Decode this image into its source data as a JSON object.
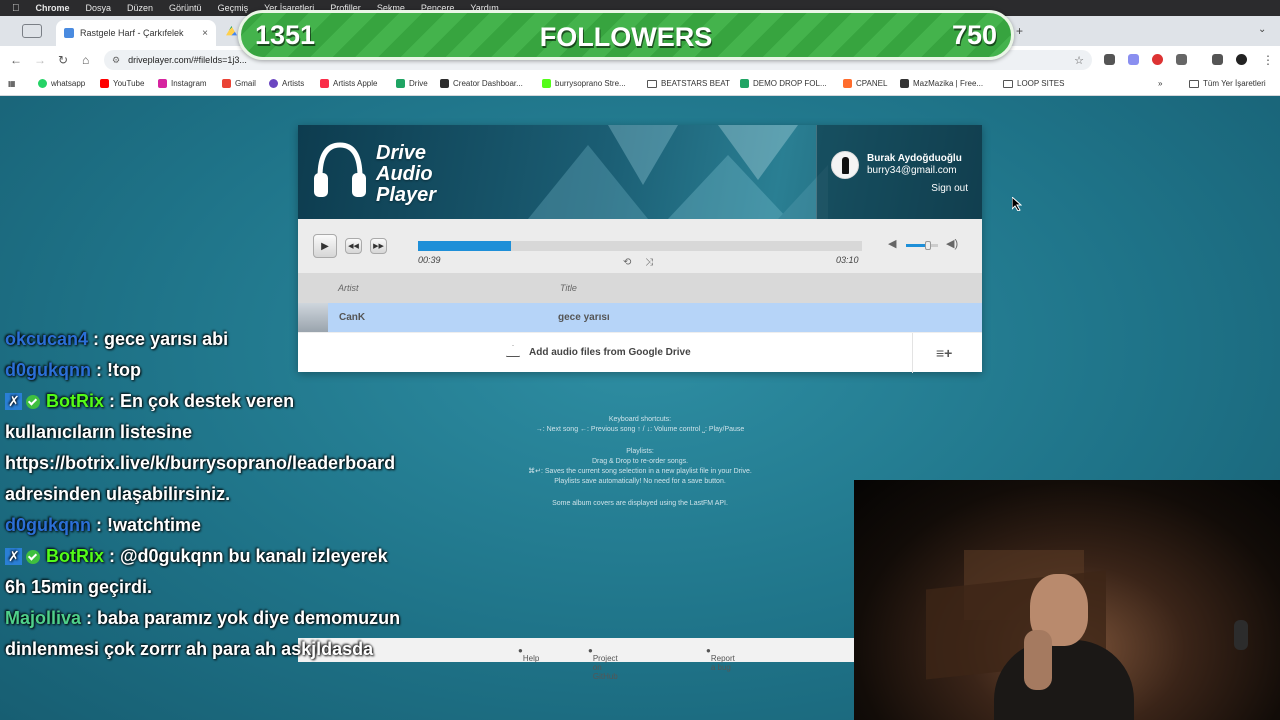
{
  "menubar": {
    "apple": "",
    "app": "Chrome",
    "items": [
      "Dosya",
      "Düzen",
      "Görüntü",
      "Geçmiş",
      "Yer İşaretleri",
      "Profiller",
      "Sekme",
      "Pencere",
      "Yardım"
    ]
  },
  "tab": {
    "title": "Rastgele Harf - Çarkıfelek",
    "close": "×"
  },
  "newtab": "+",
  "followers": {
    "left": "1351",
    "title": "FOLLOWERS",
    "right": "750"
  },
  "address": {
    "url": "driveplayer.com/#fileIds=1j3...",
    "star": "☆"
  },
  "bookmarks": [
    {
      "label": "whatsapp",
      "color": "#25d366"
    },
    {
      "label": "YouTube",
      "color": "#ff0000"
    },
    {
      "label": "Instagram",
      "color": "#d6249f"
    },
    {
      "label": "Gmail",
      "color": "#ea4335"
    },
    {
      "label": "Artists",
      "color": "#6b46c1"
    },
    {
      "label": "Artists Apple",
      "color": "#fa2d48"
    },
    {
      "label": "Drive",
      "color": "#1fa463"
    },
    {
      "label": "Creator Dashboar...",
      "color": "#2d2d2d"
    },
    {
      "label": "burrysoprano Stre...",
      "color": "#53fc18"
    },
    {
      "label": "BEATSTARS BEAT",
      "color": "folder"
    },
    {
      "label": "DEMO DROP FOL...",
      "color": "#1fa463"
    },
    {
      "label": "CPANEL",
      "color": "#ff6c2c"
    },
    {
      "label": "MazMazika | Free...",
      "color": "#333333"
    },
    {
      "label": "LOOP SITES",
      "color": "folder"
    }
  ],
  "bookmarks_more": "»",
  "bookmarks_all": "Tüm Yer İşaretleri",
  "player": {
    "logo": [
      "Drive",
      "Audio",
      "Player"
    ],
    "user_name": "Burak Aydoğduoğlu",
    "user_email": "burry34@gmail.com",
    "sign_out": "Sign out",
    "progress": 0.21,
    "time_current": "00:39",
    "time_total": "03:10",
    "volume": 0.7,
    "col_artist": "Artist",
    "col_title": "Title",
    "track_artist": "CanK",
    "track_title": "gece yarısı",
    "add_files": "Add audio files from Google Drive",
    "accent": "#1e8fd8"
  },
  "shortcuts": {
    "kb_title": "Keyboard shortcuts:",
    "kb_line": "→: Next song  ←: Previous song  ↑ / ↓: Volume control  ⎵: Play/Pause",
    "pl_title": "Playlists:",
    "pl_line1": "Drag & Drop to re-order songs.",
    "pl_line2": "⌘↵: Saves the current song selection in a new playlist file in your Drive.",
    "pl_line3": "Playlists save automatically! No need for a save button.",
    "lastfm": "Some album covers are displayed using the LastFM API."
  },
  "footer": {
    "help": "Help",
    "github": "Project on GitHub",
    "bug": "Report a bug"
  },
  "chat": [
    {
      "user": "okcucan4",
      "color": "#2b6fd6",
      "text": " : gece yarısı abi",
      "badges": false
    },
    {
      "user": "d0gukqnn",
      "color": "#2b6fd6",
      "text": " : !top",
      "badges": false
    },
    {
      "user": "BotRix",
      "color": "#53fc18",
      "text": " : En çok destek veren kullanıcıların listesine https://botrix.live/k/burrysoprano/leaderboard adresinden ulaşabilirsiniz.",
      "badges": true
    },
    {
      "user": "d0gukqnn",
      "color": "#2b6fd6",
      "text": " : !watchtime",
      "badges": false
    },
    {
      "user": "BotRix",
      "color": "#53fc18",
      "text": " : @d0gukqnn bu kanalı izleyerek 6h 15min geçirdi.",
      "badges": true
    },
    {
      "user": "Majolliva",
      "color": "#4fd08a",
      "text": " : baba paramız yok diye demomuzun dinlenmesi çok zorrr ah para ah askjldasda",
      "badges": false
    }
  ]
}
